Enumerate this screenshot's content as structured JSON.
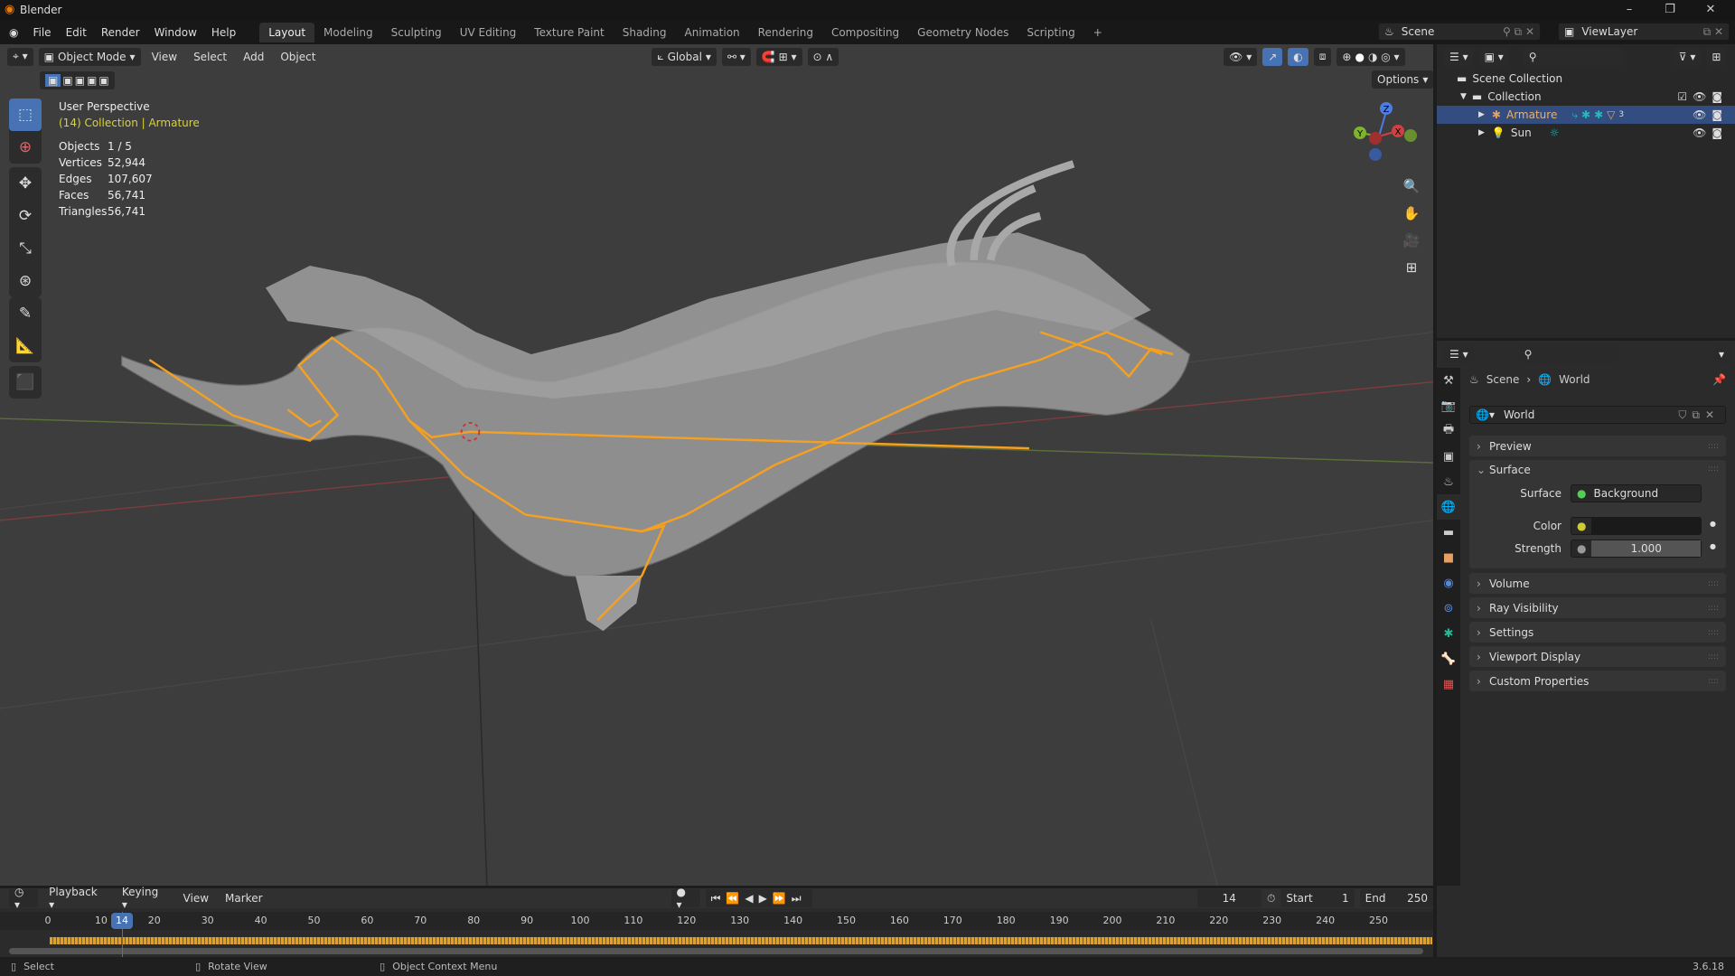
{
  "app": {
    "title": "Blender",
    "version": "3.6.18"
  },
  "menu": [
    "File",
    "Edit",
    "Render",
    "Window",
    "Help"
  ],
  "workspaces": [
    "Layout",
    "Modeling",
    "Sculpting",
    "UV Editing",
    "Texture Paint",
    "Shading",
    "Animation",
    "Rendering",
    "Compositing",
    "Geometry Nodes",
    "Scripting",
    "+"
  ],
  "active_workspace": "Layout",
  "scene": {
    "name": "Scene",
    "view_layer": "ViewLayer"
  },
  "viewport": {
    "mode": "Object Mode",
    "menus": [
      "View",
      "Select",
      "Add",
      "Object"
    ],
    "orientation": "Global",
    "options_label": "Options",
    "view_name": "User Perspective",
    "context": "(14) Collection | Armature",
    "stats": [
      {
        "label": "Objects",
        "value": "1 / 5"
      },
      {
        "label": "Vertices",
        "value": "52,944"
      },
      {
        "label": "Edges",
        "value": "107,607"
      },
      {
        "label": "Faces",
        "value": "56,741"
      },
      {
        "label": "Triangles",
        "value": "56,741"
      }
    ],
    "gizmo": {
      "x": "X",
      "y": "Y",
      "z": "Z"
    },
    "colors": {
      "armature": "#f5a020",
      "mesh": "#9a9a9a",
      "accent": "#4772b3"
    }
  },
  "outliner": {
    "items": [
      {
        "label": "Scene Collection",
        "icon": "collection-icon"
      },
      {
        "label": "Collection",
        "icon": "collection-icon"
      },
      {
        "label": "Armature",
        "icon": "armature-icon",
        "badge": "3",
        "selected": true
      },
      {
        "label": "Sun",
        "icon": "light-icon"
      }
    ]
  },
  "properties": {
    "breadcrumb": [
      "Scene",
      "World"
    ],
    "world_name": "World",
    "panels": [
      "Preview",
      "Surface",
      "Volume",
      "Ray Visibility",
      "Settings",
      "Viewport Display",
      "Custom Properties"
    ],
    "surface": {
      "surface_label": "Surface",
      "surface_value": "Background",
      "color_label": "Color",
      "color_value": "#1a1a1a",
      "strength_label": "Strength",
      "strength_value": "1.000"
    }
  },
  "timeline": {
    "menus": [
      "Playback",
      "Keying",
      "View",
      "Marker"
    ],
    "current_frame": "14",
    "start_label": "Start",
    "start": "1",
    "end_label": "End",
    "end": "250",
    "ticks": [
      "0",
      "10",
      "20",
      "30",
      "40",
      "50",
      "60",
      "70",
      "80",
      "90",
      "100",
      "110",
      "120",
      "130",
      "140",
      "150",
      "160",
      "170",
      "180",
      "190",
      "200",
      "210",
      "220",
      "230",
      "240",
      "250"
    ]
  },
  "statusbar": {
    "items": [
      "Select",
      "Rotate View",
      "Object Context Menu"
    ]
  }
}
